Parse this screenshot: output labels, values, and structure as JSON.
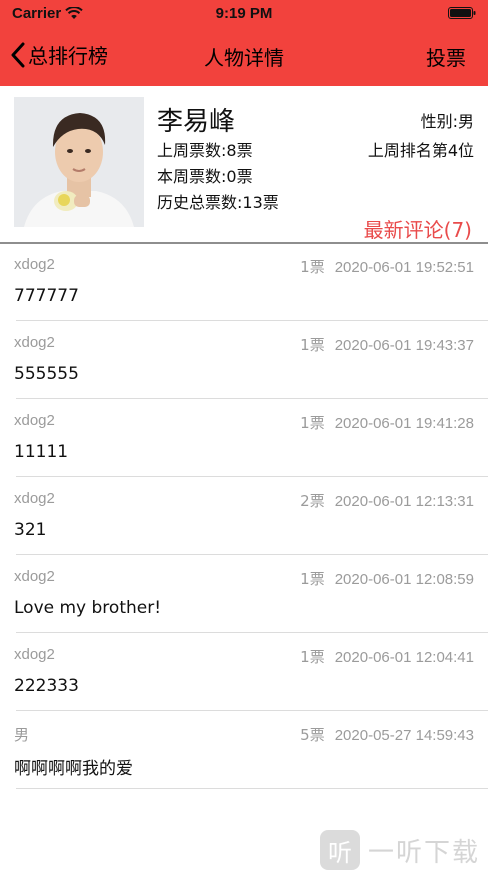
{
  "status_bar": {
    "carrier": "Carrier",
    "time": "9:19 PM"
  },
  "nav": {
    "back_label": "总排行榜",
    "title": "人物详情",
    "vote_label": "投票"
  },
  "profile": {
    "name": "李易峰",
    "gender": "性别:男",
    "last_week_votes": "上周票数:8票",
    "last_week_rank": "上周排名第4位",
    "this_week_votes": "本周票数:0票",
    "total_votes": "历史总票数:13票",
    "latest_comments": "最新评论(7)"
  },
  "comments": [
    {
      "user": "xdog2",
      "votes": "1票",
      "date": "2020-06-01 19:52:51",
      "text": "777777"
    },
    {
      "user": "xdog2",
      "votes": "1票",
      "date": "2020-06-01 19:43:37",
      "text": "555555"
    },
    {
      "user": "xdog2",
      "votes": "1票",
      "date": "2020-06-01 19:41:28",
      "text": "11111"
    },
    {
      "user": "xdog2",
      "votes": "2票",
      "date": "2020-06-01 12:13:31",
      "text": "321"
    },
    {
      "user": "xdog2",
      "votes": "1票",
      "date": "2020-06-01 12:08:59",
      "text": "Love my brother!"
    },
    {
      "user": "xdog2",
      "votes": "1票",
      "date": "2020-06-01 12:04:41",
      "text": "222333"
    },
    {
      "user": "男",
      "votes": "5票",
      "date": "2020-05-27 14:59:43",
      "text": "啊啊啊啊我的爱"
    }
  ],
  "watermark": {
    "logo": "听",
    "text": "一听下载"
  },
  "colors": {
    "header": "#f2423d",
    "accent_text": "#e94b4b",
    "meta_text": "#9b9b9b"
  }
}
